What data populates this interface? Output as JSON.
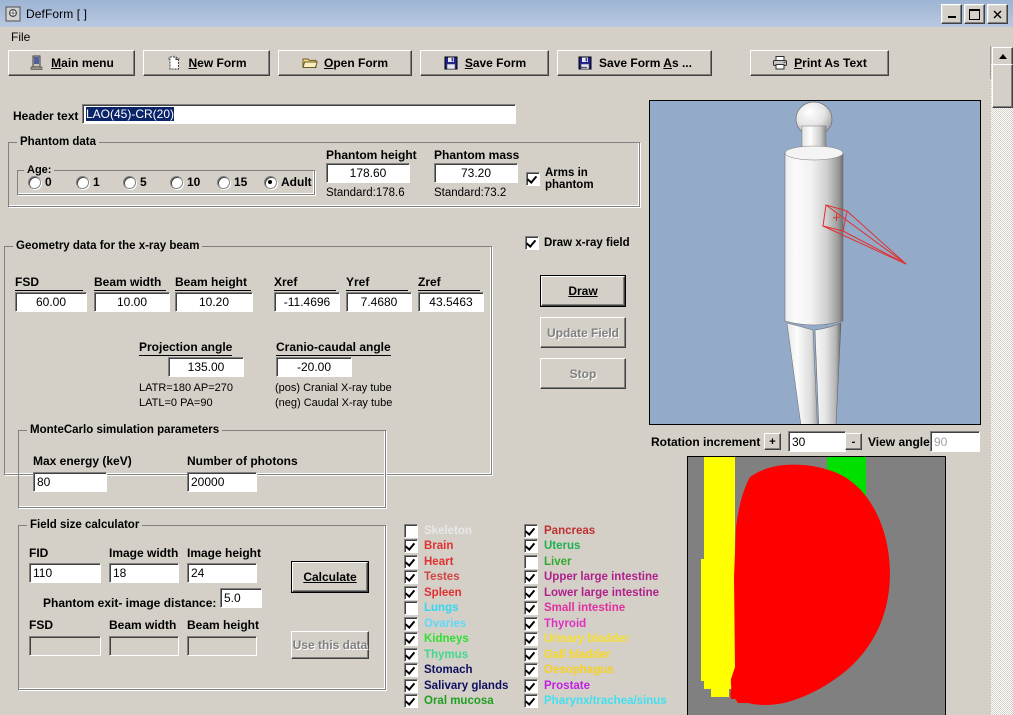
{
  "window": {
    "title": "DefForm  [ ]",
    "minimize": "_",
    "maximize": "□",
    "close": "✕"
  },
  "menu": {
    "items": [
      "File"
    ]
  },
  "toolbar": {
    "buttons": [
      {
        "label": "Main menu",
        "icon": "door-exit-icon",
        "accel": "M"
      },
      {
        "label": "New Form",
        "icon": "new-document-icon",
        "accel": "N"
      },
      {
        "label": "Open Form",
        "icon": "folder-open-icon",
        "accel": "O"
      },
      {
        "label": "Save Form",
        "icon": "floppy-disk-icon",
        "accel": "S"
      },
      {
        "label": "Save Form As ...",
        "icon": "floppy-disk-dots-icon",
        "accel": "A"
      },
      {
        "label": "Print As Text",
        "icon": "printer-icon",
        "accel": "P"
      }
    ]
  },
  "header": {
    "label": "Header text",
    "value": "LAO(45)-CR(20)"
  },
  "phantom_data": {
    "title": "Phantom data",
    "age": {
      "label": "Age:",
      "options": [
        "0",
        "1",
        "5",
        "10",
        "15",
        "Adult"
      ],
      "selected": "Adult"
    },
    "height": {
      "label": "Phantom height",
      "value": "178.60",
      "standard": "Standard:178.6"
    },
    "mass": {
      "label": "Phantom mass",
      "value": "73.20",
      "standard": "Standard:73.2"
    },
    "arms": {
      "label": "Arms in phantom",
      "checked": true
    }
  },
  "geometry": {
    "title": "Geometry data for the x-ray beam",
    "fields": [
      {
        "label": "FSD",
        "value": "60.00"
      },
      {
        "label": "Beam width",
        "value": "10.00"
      },
      {
        "label": "Beam height",
        "value": "10.20"
      },
      {
        "label": "Xref",
        "value": "-11.4696"
      },
      {
        "label": "Yref",
        "value": "7.4680"
      },
      {
        "label": "Zref",
        "value": "43.5463"
      }
    ],
    "projection": {
      "label": "Projection angle",
      "value": "135.00"
    },
    "cranio": {
      "label": "Cranio-caudal angle",
      "value": "-20.00"
    },
    "notes_left": [
      "LATR=180   AP=270",
      "LATL=0        PA=90"
    ],
    "notes_right": [
      "(pos) Cranial X-ray tube",
      "(neg) Caudal X-ray tube"
    ]
  },
  "montecarlo": {
    "title": "MonteCarlo simulation parameters",
    "max_energy": {
      "label": "Max energy (keV)",
      "value": "80"
    },
    "photons": {
      "label": "Number of photons",
      "value": "20000"
    }
  },
  "field_calc": {
    "title": "Field size calculator",
    "fid": {
      "label": "FID",
      "value": "110"
    },
    "image_width": {
      "label": "Image width",
      "value": "18"
    },
    "image_height": {
      "label": "Image height",
      "value": "24"
    },
    "exit_distance": {
      "label": "Phantom exit- image distance:",
      "value": "5.0"
    },
    "fsd": {
      "label": "FSD",
      "value": ""
    },
    "beam_width": {
      "label": "Beam width",
      "value": ""
    },
    "beam_height": {
      "label": "Beam height",
      "value": ""
    },
    "calculate_button": "Calculate",
    "use_button": "Use this data"
  },
  "draw_panel": {
    "draw_field_checkbox": {
      "label": "Draw x-ray field",
      "checked": true
    },
    "draw_button": "Draw",
    "update_button": "Update Field",
    "stop_button": "Stop"
  },
  "rotation": {
    "label": "Rotation increment",
    "plus": "+",
    "minus": "-",
    "increment": "30",
    "view_angle_label": "View angle",
    "view_angle_sep": ":",
    "view_angle": "90"
  },
  "organs": {
    "left_column": [
      {
        "name": "Skeleton",
        "checked": false,
        "color": "#e8e8e8"
      },
      {
        "name": "Brain",
        "checked": true,
        "color": "#e03030"
      },
      {
        "name": "Heart",
        "checked": true,
        "color": "#e03030"
      },
      {
        "name": "Testes",
        "checked": true,
        "color": "#d24545"
      },
      {
        "name": "Spleen",
        "checked": true,
        "color": "#e03030"
      },
      {
        "name": "Lungs",
        "checked": false,
        "color": "#30d8f0"
      },
      {
        "name": "Ovaries",
        "checked": true,
        "color": "#60d8f8"
      },
      {
        "name": "Kidneys",
        "checked": true,
        "color": "#30e030"
      },
      {
        "name": "Thymus",
        "checked": true,
        "color": "#40d890"
      },
      {
        "name": "Stomach",
        "checked": true,
        "color": "#101060"
      },
      {
        "name": "Salivary glands",
        "checked": true,
        "color": "#101060"
      },
      {
        "name": "Oral mucosa",
        "checked": true,
        "color": "#20a020"
      }
    ],
    "right_column": [
      {
        "name": "Pancreas",
        "checked": true,
        "color": "#c03030"
      },
      {
        "name": "Uterus",
        "checked": true,
        "color": "#20b050"
      },
      {
        "name": "Liver",
        "checked": false,
        "color": "#30a830"
      },
      {
        "name": "Upper large intestine",
        "checked": true,
        "color": "#b0208c"
      },
      {
        "name": "Lower large intestine",
        "checked": true,
        "color": "#b0208c"
      },
      {
        "name": "Small intestine",
        "checked": true,
        "color": "#e030a0"
      },
      {
        "name": "Thyroid",
        "checked": true,
        "color": "#e030c0"
      },
      {
        "name": "Urinary bladder",
        "checked": true,
        "color": "#f8e030"
      },
      {
        "name": "Gall bladder",
        "checked": true,
        "color": "#f8d820"
      },
      {
        "name": "Oesophagus",
        "checked": true,
        "color": "#f8d020"
      },
      {
        "name": "Prostate",
        "checked": true,
        "color": "#c020e0"
      },
      {
        "name": "Pharynx/trachea/sinus",
        "checked": true,
        "color": "#40e0f0"
      }
    ]
  },
  "colors": {
    "viewport_background": "#93aac8",
    "image_background": "#808080",
    "image_red": "#ff0000",
    "image_yellow": "#ffff00",
    "image_green": "#00e000",
    "beam_outline": "#e03030",
    "window_face": "#d4d0c8",
    "titlebar_gradient_start": "#9cb4d4"
  }
}
